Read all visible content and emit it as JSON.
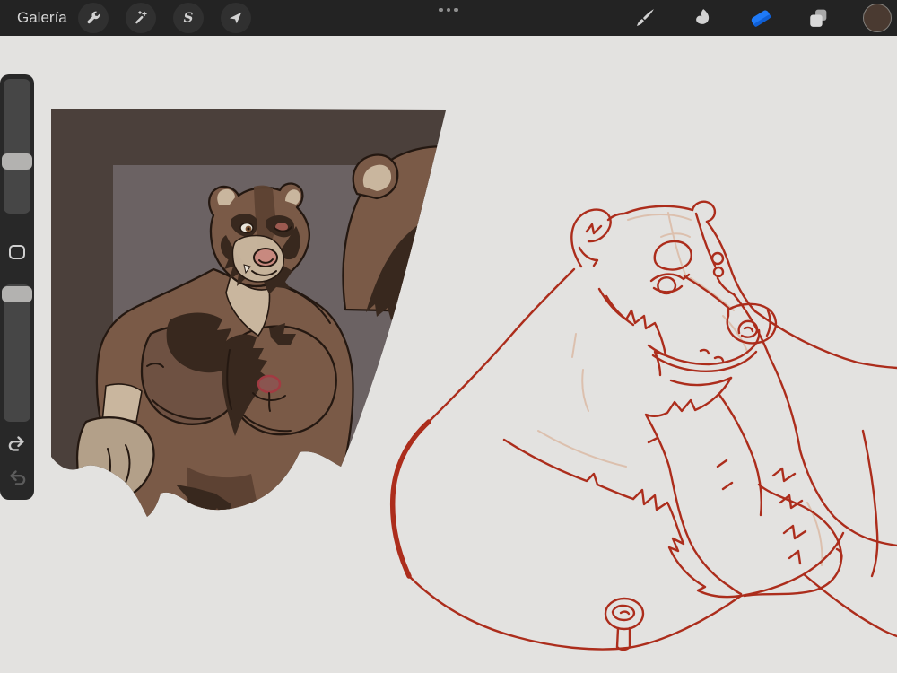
{
  "topbar": {
    "gallery_label": "Galería",
    "left_tools": [
      {
        "icon": "wrench-icon"
      },
      {
        "icon": "magic-wand-icon"
      },
      {
        "icon": "selection-s-icon"
      },
      {
        "icon": "transform-arrow-icon"
      }
    ],
    "center_icon": "ellipsis-icon",
    "right_tools": [
      {
        "icon": "paintbrush-icon",
        "active": false
      },
      {
        "icon": "smudge-icon",
        "active": false
      },
      {
        "icon": "eraser-icon",
        "active": true
      },
      {
        "icon": "layers-icon",
        "active": false
      },
      {
        "icon": "color-swatch",
        "active": false,
        "swatch_color": "#4a3a31"
      }
    ]
  },
  "sidebar": {
    "sliders": [
      {
        "name": "brush-size-slider",
        "handle_pct": 55
      },
      {
        "name": "opacity-slider",
        "handle_pct": 1
      }
    ],
    "modify_icon": "modify-square-icon",
    "undo_icon": "undo-arrow-icon",
    "redo_icon": "redo-arrow-icon"
  },
  "colors": {
    "topbar_bg": "#232323",
    "topbar_circle": "#303030",
    "icon_light": "#d2d2d2",
    "accent_blue": "#1f7af7",
    "swatch_brown": "#4a3a31",
    "swatch_ring": "#83807c",
    "canvas_bg": "#e3e2e0",
    "sidebar_bg": "#282828",
    "slider_track": "#464646",
    "slider_handle": "#b3b2b0",
    "undo_color": "#c9c9c9",
    "redo_color": "#5c5c5c",
    "paint_bg": "#4b403b",
    "doorway": "#6b6263",
    "bear_body": "#7a5a47",
    "bear_dark": "#38281e",
    "bear_mid": "#5d4233",
    "bear_cream": "#c9b69e",
    "bear_shade": "#6e5142",
    "outline_dark": "#241811",
    "nose_pink": "#c8897f",
    "nipple_red": "#a13b42",
    "sketch_red": "#ac2d1c",
    "sketch_faint": "#dcc0ae",
    "paw_cream": "#b3a089"
  }
}
